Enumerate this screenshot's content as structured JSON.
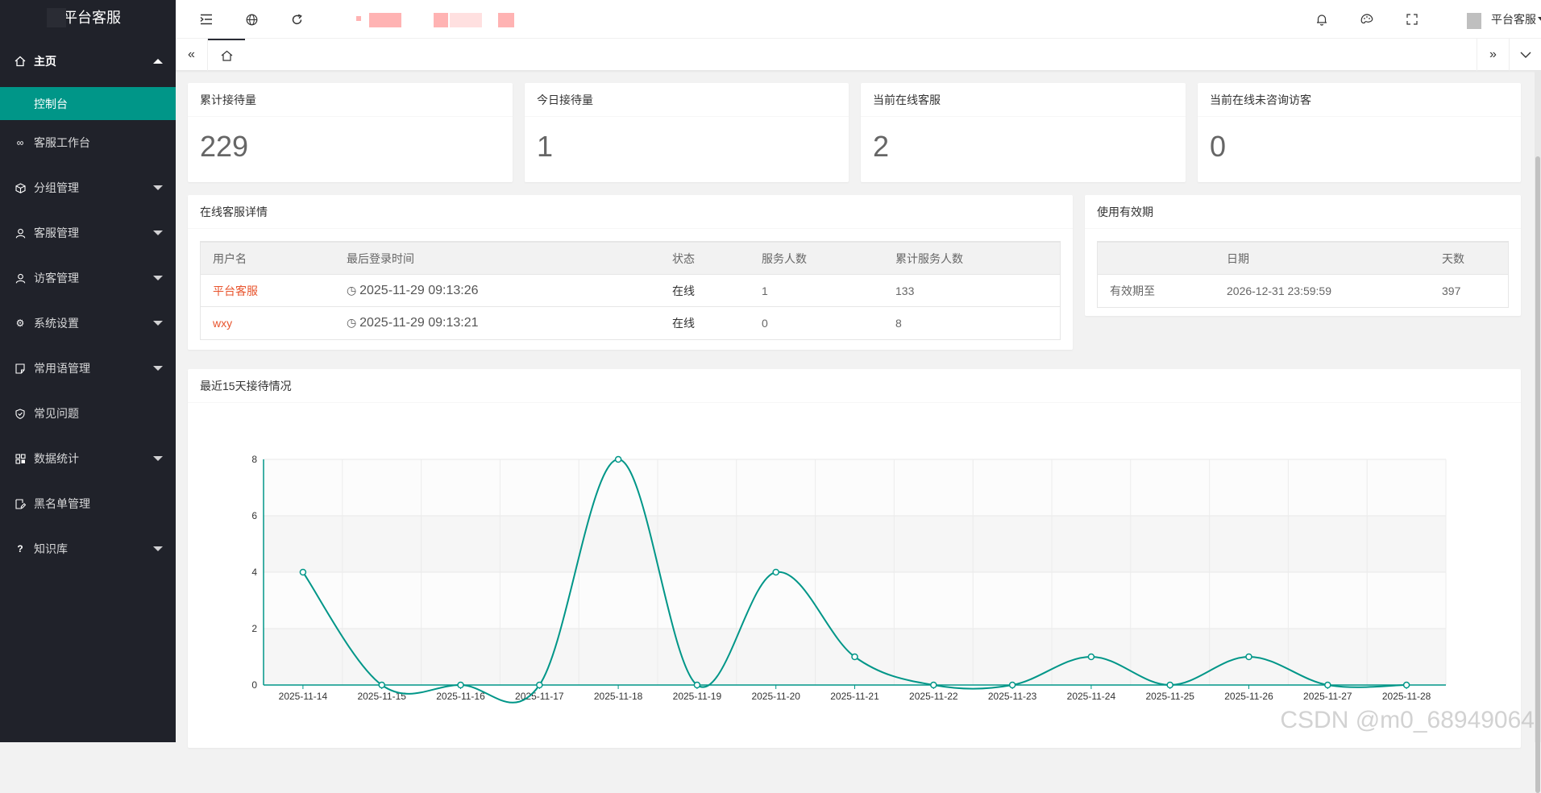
{
  "app": {
    "title": "平台客服"
  },
  "sidebar": {
    "items": [
      {
        "label": "主页",
        "icon": "home-icon",
        "open": true
      },
      {
        "label": "控制台",
        "active": true
      },
      {
        "label": "客服工作台",
        "icon": "link-icon"
      },
      {
        "label": "分组管理",
        "icon": "cube-icon"
      },
      {
        "label": "客服管理",
        "icon": "user-icon"
      },
      {
        "label": "访客管理",
        "icon": "user-icon"
      },
      {
        "label": "系统设置",
        "icon": "gear-icon"
      },
      {
        "label": "常用语管理",
        "icon": "note-icon"
      },
      {
        "label": "常见问题",
        "icon": "shield-icon"
      },
      {
        "label": "数据统计",
        "icon": "app-icon"
      },
      {
        "label": "黑名单管理",
        "icon": "edit-icon"
      },
      {
        "label": "知识库",
        "icon": "question-icon"
      }
    ]
  },
  "header": {
    "user_name": "平台客服"
  },
  "stats": [
    {
      "label": "累计接待量",
      "value": "229"
    },
    {
      "label": "今日接待量",
      "value": "1"
    },
    {
      "label": "当前在线客服",
      "value": "2"
    },
    {
      "label": "当前在线未咨询访客",
      "value": "0"
    }
  ],
  "online": {
    "title": "在线客服详情",
    "columns": [
      "用户名",
      "最后登录时间",
      "状态",
      "服务人数",
      "累计服务人数"
    ],
    "rows": [
      {
        "name": "平台客服",
        "time": "2025-11-29 09:13:26",
        "status": "在线",
        "serving": "1",
        "total": "133"
      },
      {
        "name": "wxy",
        "time": "2025-11-29 09:13:21",
        "status": "在线",
        "serving": "0",
        "total": "8"
      }
    ]
  },
  "validity": {
    "title": "使用有效期",
    "columns": [
      "",
      "日期",
      "天数"
    ],
    "row": {
      "label": "有效期至",
      "date": "2026-12-31 23:59:59",
      "days": "397"
    }
  },
  "chart_card": {
    "title": "最近15天接待情况"
  },
  "chart_data": {
    "type": "line",
    "title": "最近15天接待情况",
    "categories": [
      "2025-11-14",
      "2025-11-15",
      "2025-11-16",
      "2025-11-17",
      "2025-11-18",
      "2025-11-19",
      "2025-11-20",
      "2025-11-21",
      "2025-11-22",
      "2025-11-23",
      "2025-11-24",
      "2025-11-25",
      "2025-11-26",
      "2025-11-27",
      "2025-11-28"
    ],
    "values": [
      4,
      0,
      0,
      0,
      8,
      0,
      4,
      1,
      0,
      0,
      1,
      0,
      1,
      0,
      0
    ],
    "ylim": [
      0,
      8
    ],
    "yticks": [
      0,
      2,
      4,
      6,
      8
    ],
    "color": "#009688",
    "smooth": true,
    "grid": true
  },
  "watermark": "CSDN @m0_68949064",
  "colors": {
    "accent": "#009688",
    "sidebar_bg": "#20222a",
    "link_red": "#e8542d"
  }
}
